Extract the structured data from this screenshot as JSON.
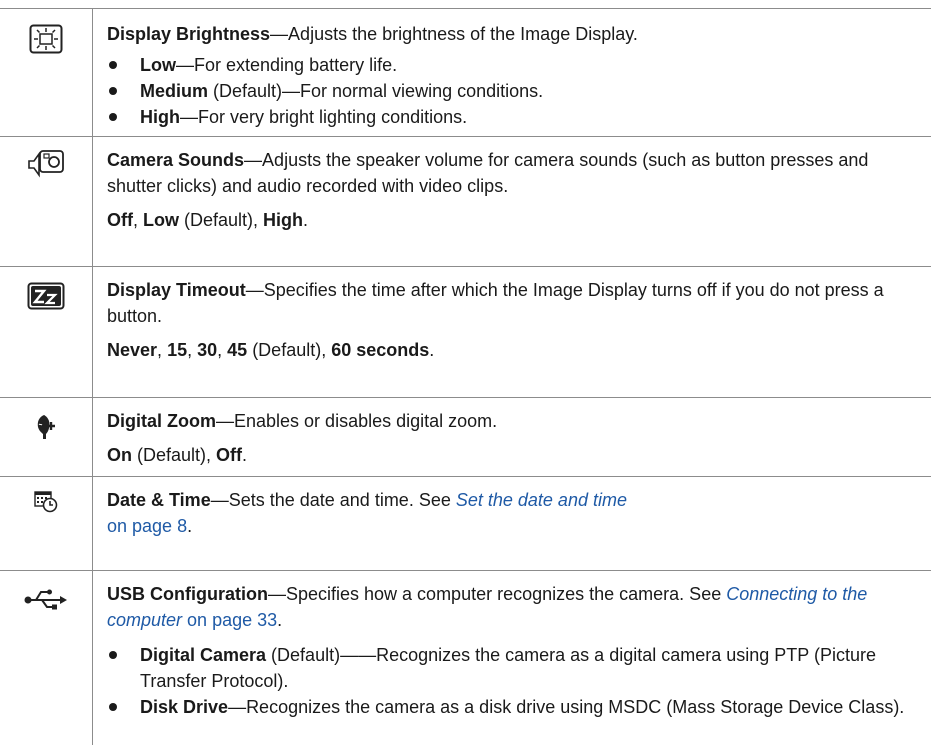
{
  "rows": {
    "display_brightness": {
      "icon": "brightness-icon",
      "title": "Display Brightness",
      "desc": "—Adjusts the brightness of the Image Display.",
      "bullets": [
        {
          "term": "Low",
          "text": "—For extending battery life."
        },
        {
          "term": "Medium",
          "text": " (Default)—For normal viewing conditions."
        },
        {
          "term": "High",
          "text": "—For very bright lighting conditions."
        }
      ]
    },
    "camera_sounds": {
      "icon": "speaker-icon",
      "title": "Camera Sounds",
      "desc": "—Adjusts the speaker volume for camera sounds (such as button presses and shutter clicks) and audio recorded with video clips.",
      "opt1": "Off",
      "sep1": ", ",
      "opt2": "Low",
      "opt2_suffix": " (Default), ",
      "opt3": "High",
      "end": "."
    },
    "display_timeout": {
      "icon": "sleep-zz-icon",
      "title": "Display Timeout",
      "desc": "—Specifies the time after which the Image Display turns off if you do not press a button.",
      "opt1": "Never",
      "sep": ", ",
      "opt2": "15",
      "opt3": "30",
      "opt4": "45",
      "opt4_suffix": " (Default), ",
      "opt5": "60 seconds",
      "end": "."
    },
    "digital_zoom": {
      "icon": "digital-zoom-icon",
      "title": "Digital Zoom",
      "desc": "—Enables or disables digital zoom.",
      "opt1": "On",
      "opt1_suffix": " (Default), ",
      "opt2": "Off",
      "end": "."
    },
    "date_time": {
      "icon": "calendar-clock-icon",
      "title": "Date & Time",
      "desc": "—Sets the date and time. See ",
      "link_text": "Set the date and time",
      "link_page": "on page 8",
      "end": "."
    },
    "usb_configuration": {
      "icon": "usb-icon",
      "title": "USB Configuration",
      "desc": "—Specifies how a computer recognizes the camera. See ",
      "link_text": "Connecting to the computer",
      "link_page": " on page 33",
      "end": ".",
      "bullets": [
        {
          "term": "Digital Camera",
          "text": " (Default)——Recognizes the camera as a digital camera using PTP (Picture Transfer Protocol)."
        },
        {
          "term": "Disk Drive",
          "text": "—Recognizes the camera as a disk drive using MSDC (Mass Storage Device Class)."
        }
      ]
    }
  },
  "colors": {
    "link": "#1f5aa6",
    "rule": "#8c8c8c",
    "text": "#1a1a1a"
  }
}
